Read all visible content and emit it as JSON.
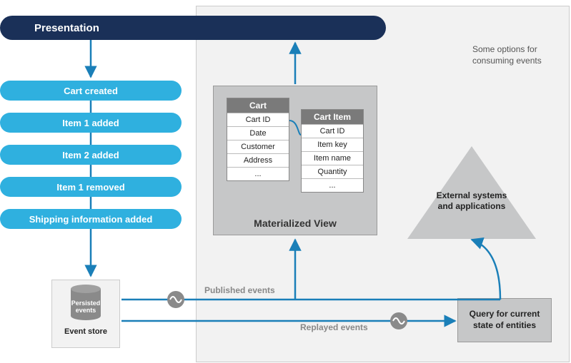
{
  "presentation": {
    "title": "Presentation"
  },
  "panel": {
    "note": "Some options for consuming events"
  },
  "events": [
    "Cart created",
    "Item 1 added",
    "Item 2 added",
    "Item 1 removed",
    "Shipping information added"
  ],
  "materialized_view": {
    "title": "Materialized View",
    "tables": {
      "cart": {
        "header": "Cart",
        "rows": [
          "Cart ID",
          "Date",
          "Customer",
          "Address",
          "..."
        ]
      },
      "cart_item": {
        "header": "Cart Item",
        "rows": [
          "Cart ID",
          "Item key",
          "Item name",
          "Quantity",
          "..."
        ]
      }
    }
  },
  "event_store": {
    "cylinder_label": "Persisted events",
    "caption": "Event store"
  },
  "external": {
    "label": "External systems and applications"
  },
  "query": {
    "label": "Query for current state of entities"
  },
  "flow_labels": {
    "published": "Published events",
    "replayed": "Replayed events"
  },
  "colors": {
    "arrow": "#1a7fb8",
    "pill": "#2fb0df",
    "grey": "#c6c7c8",
    "navy": "#1a3058"
  }
}
